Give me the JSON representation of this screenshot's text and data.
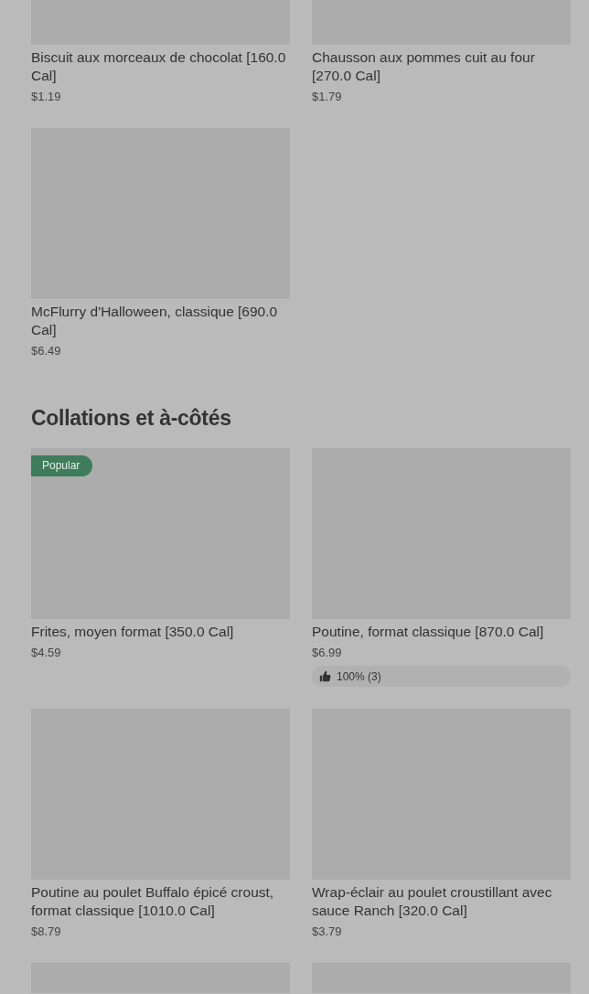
{
  "sections": [
    {
      "items": [
        {
          "kind": "card",
          "title": "Biscuit aux morceaux de chocolat [160.0 Cal]",
          "price": "$1.19"
        },
        {
          "kind": "card",
          "title": "Chausson aux pommes cuit au four [270.0 Cal]",
          "price": "$1.79"
        },
        {
          "kind": "card",
          "title": "McFlurry d'Halloween, classique [690.0 Cal]",
          "price": "$6.49"
        }
      ]
    },
    {
      "title": "Collations et à-côtés",
      "items": [
        {
          "kind": "card",
          "title": "Frites, moyen format [350.0 Cal]",
          "price": "$4.59",
          "badge": "Popular"
        },
        {
          "kind": "card",
          "title": "Poutine, format classique [870.0 Cal]",
          "price": "$6.99",
          "rating": "100% (3)"
        },
        {
          "kind": "card",
          "title": "Poutine au poulet Buffalo épicé croust, format classique [1010.0 Cal]",
          "price": "$8.79"
        },
        {
          "kind": "card",
          "title": "Wrap-éclair au poulet croustillant avec sauce Ranch [320.0 Cal]",
          "price": "$3.79"
        },
        {
          "kind": "image"
        },
        {
          "kind": "image"
        }
      ]
    }
  ]
}
